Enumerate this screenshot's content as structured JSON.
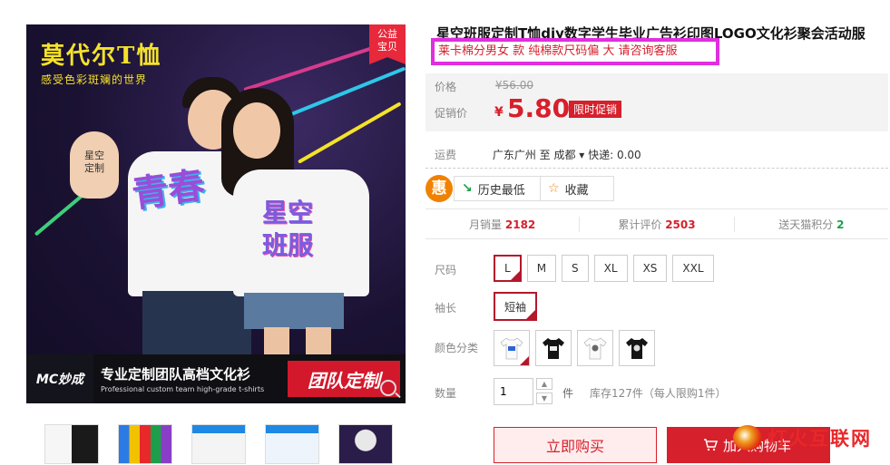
{
  "main_image": {
    "brand_line1": "莫代尔T恤",
    "brand_line2": "感受色彩斑斓的世界",
    "charity_badge": [
      "公益",
      "宝贝"
    ],
    "palm_text": [
      "星空",
      "定制"
    ],
    "shirt_art_left": "青春",
    "shirt_art_right": "星空\n班服",
    "banner_logo": "MC妙成",
    "banner_text_cn": "专业定制团队高档文化衫",
    "banner_text_en": "Professional custom team high-grade t-shirts",
    "banner_red": "团队定制"
  },
  "product": {
    "title": "星空班服定制T恤diy数字学生毕业广告衫印图LOGO文化衫聚会活动服",
    "subtitle": "莱卡棉分男女 款 纯棉款尺码偏 大 请咨询客服"
  },
  "price": {
    "price_label": "价格",
    "old_price": "¥56.00",
    "promo_label": "促销价",
    "currency": "¥",
    "promo_price": "5.80",
    "promo_tag": "限时促销"
  },
  "shipping": {
    "label": "运费",
    "value": "广东广州 至 成都 ▾ 快递: 0.00"
  },
  "actions": {
    "hui": "惠",
    "history": "历史最低",
    "favorite": "收藏"
  },
  "stats": [
    {
      "label": "月销量",
      "value": "2182"
    },
    {
      "label": "累计评价",
      "value": "2503"
    },
    {
      "label": "送天猫积分",
      "value": "2"
    }
  ],
  "options": {
    "size_label": "尺码",
    "sizes": [
      "L",
      "M",
      "S",
      "XL",
      "XS",
      "XXL"
    ],
    "selected_size": "L",
    "sleeve_label": "袖长",
    "sleeve_value": "短袖",
    "color_label": "颜色分类",
    "quantity_label": "数量",
    "quantity": "1",
    "unit": "件",
    "stock": "库存127件（每人限购1件）"
  },
  "buttons": {
    "buy_now": "立即购买",
    "add_to_cart": "加入购物车"
  },
  "watermark": "灯火互联网",
  "colors": {
    "accent": "#d6202c",
    "highlight_border": "#e02ee0",
    "orange": "#f08200",
    "green": "#1e9e4b"
  }
}
